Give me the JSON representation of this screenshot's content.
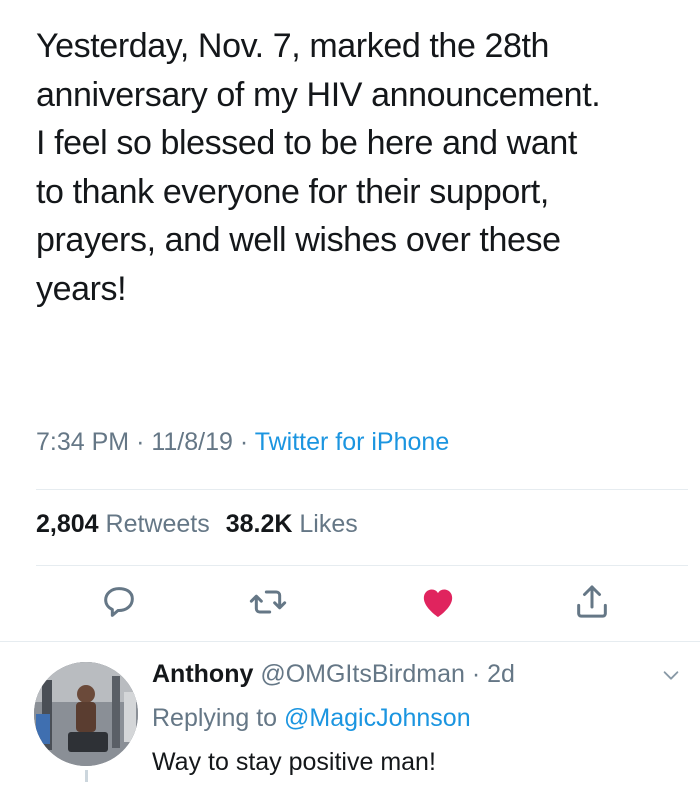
{
  "tweet": {
    "text": "Yesterday, Nov. 7, marked the 28th\nanniversary of my HIV announcement.\nI feel so blessed to be here and want\nto thank everyone for their support,\nprayers, and well wishes over these\nyears!",
    "time": "7:34 PM",
    "sep": "·",
    "date": "11/8/19",
    "source": "Twitter for iPhone"
  },
  "stats": {
    "retweets_count": "2,804",
    "retweets_label": "Retweets",
    "likes_count": "38.2K",
    "likes_label": "Likes"
  },
  "actions": {
    "reply_icon": "reply-icon",
    "retweet_icon": "retweet-icon",
    "like_icon": "heart-icon",
    "share_icon": "share-icon",
    "like_color": "#e0245e",
    "icon_color": "#657786"
  },
  "reply": {
    "name": "Anthony",
    "handle": "@OMGItsBirdman",
    "sep": "·",
    "age": "2d",
    "replying_prefix": "Replying to",
    "replying_to": "@MagicJohnson",
    "text": "Way to stay positive man!"
  },
  "colors": {
    "text": "#14171a",
    "secondary": "#657786",
    "link": "#1b95e0",
    "divider": "#e6ecf0"
  }
}
